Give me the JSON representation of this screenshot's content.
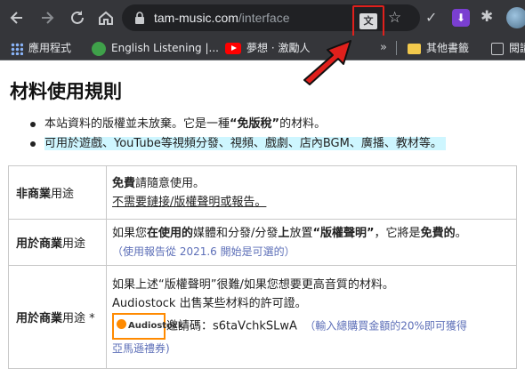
{
  "browser": {
    "url_domain": "tam-music.com",
    "url_path": "/interface",
    "nav_icons": [
      "back-icon",
      "forward-icon",
      "reload-icon",
      "home-icon"
    ],
    "extension_icons": [
      "translate-icon",
      "star-icon",
      "check-icon",
      "download-extension-icon",
      "puzzle-icon",
      "avatar"
    ]
  },
  "bookmarks": {
    "items": [
      {
        "label": "應用程式",
        "icon": "apps-grid-icon"
      },
      {
        "label": "English Listening |...",
        "icon": "green-circle-icon"
      },
      {
        "label": "夢想 · 激勵人",
        "icon": "youtube-icon"
      }
    ],
    "overflow": "»",
    "other_bookmarks": "其他書籤",
    "reading_list": "閱讀"
  },
  "page": {
    "title": "材料使用規則",
    "notes": [
      {
        "pre": "本站資料的版權並未放棄。它是一種",
        "bold": "“免版稅”",
        "post": "的材料。"
      },
      {
        "text": "可用於遊戲、YouTube等視頻分發、視頻、戲劇、店內BGM、廣播、教材等。"
      }
    ],
    "rows": [
      {
        "label_bold": "非商業",
        "label_rest": "用途",
        "line1_bold": "免費",
        "line1_rest": "請隨意使用。",
        "line2": "不需要鏈接/版權聲明或報告。"
      },
      {
        "label_bold": "用於商業",
        "label_rest": "用途",
        "line1_a": "如果您",
        "line1_b": "在使用的",
        "line1_c": "媒體和分發/分發",
        "line1_d": "上",
        "line1_e": "放置",
        "line1_f": "“版權聲明”",
        "line1_g": "，它將是",
        "line1_h": "免費的",
        "line1_i": "。",
        "line2": "（使用報告從 2021.6 開始是可選的）"
      },
      {
        "label_bold": "用於商業",
        "label_rest": "用途 *",
        "line1": "如果上述“版權聲明”很難/如果您想要更高音質的材料。",
        "line2": "Audiostock 出售某些材料的許可證。",
        "logo_text": "Audiostock",
        "code_text": "邀請碼：s6taVchkSLwA",
        "code_note": "（輸入總購買金額的20%即可獲得",
        "code_note2": "亞馬遜禮券)"
      }
    ]
  },
  "colors": {
    "chrome_bg": "#35363a",
    "highlight": "#cef6ff",
    "annotation_red": "#e0201c",
    "note_blue": "#5d6fb8",
    "logo_orange": "#ff8a00"
  }
}
